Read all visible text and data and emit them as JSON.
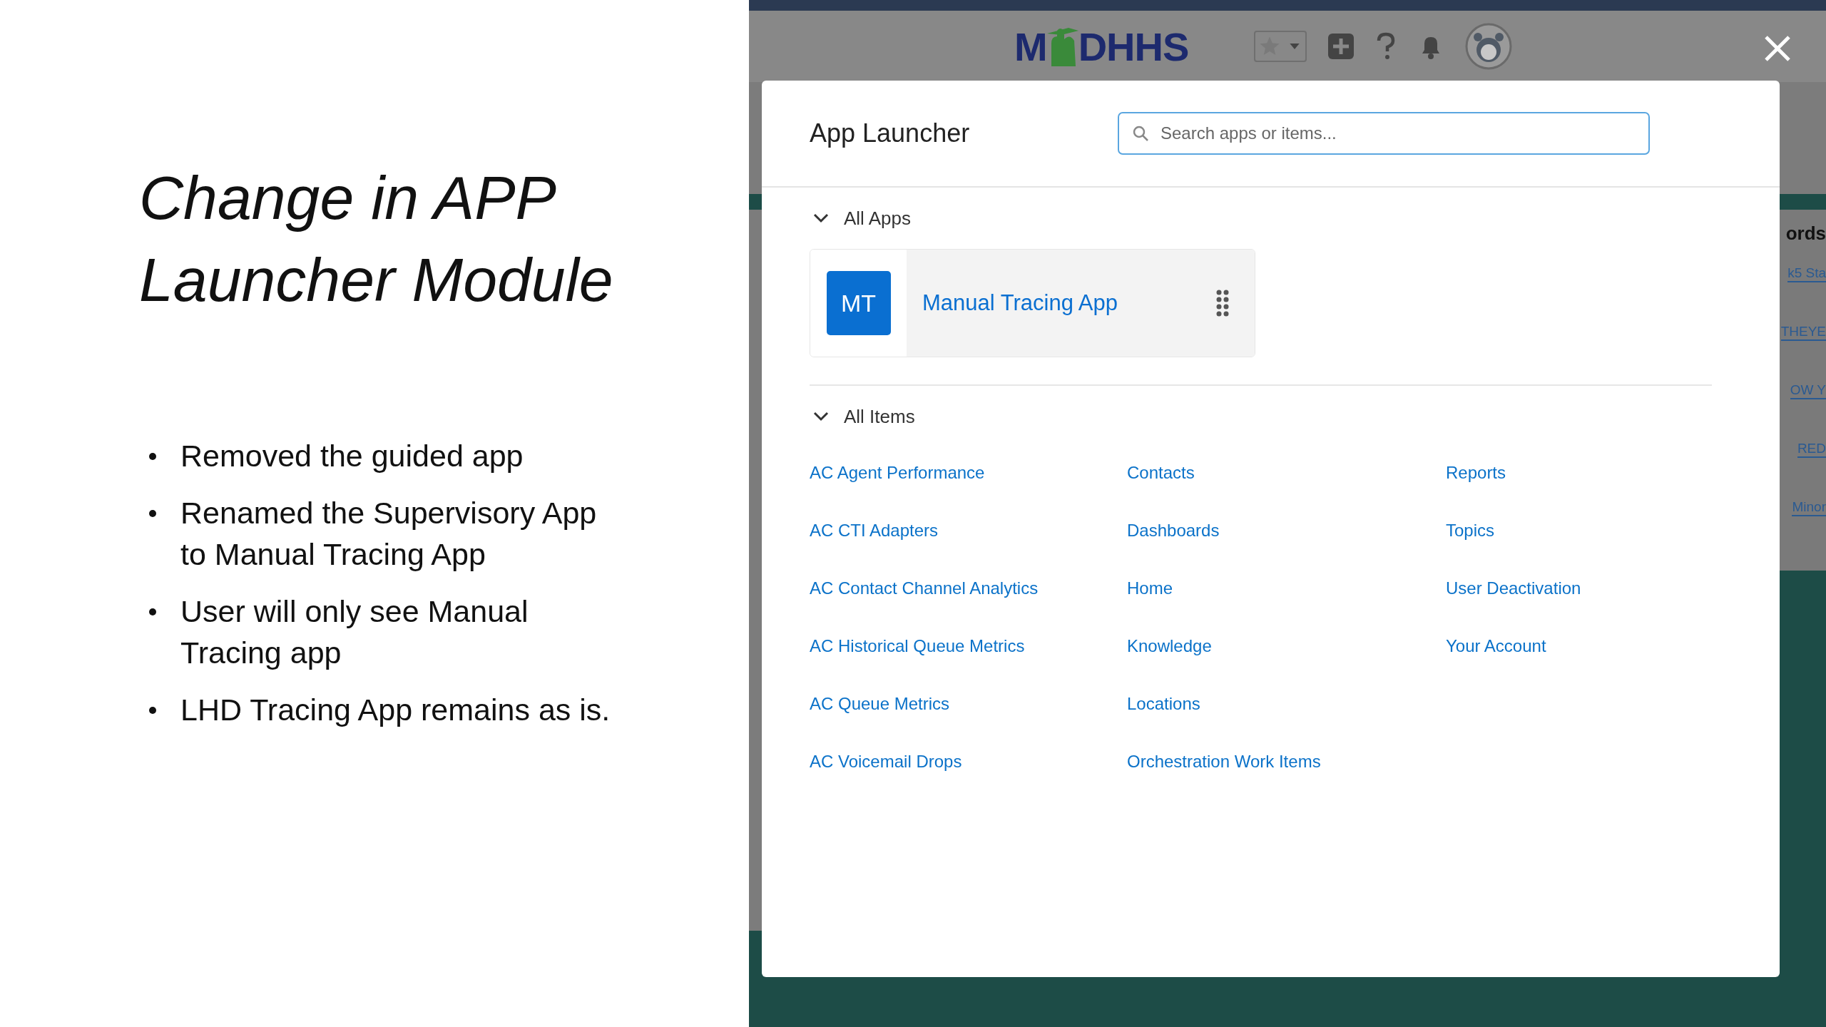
{
  "slide": {
    "title": "Change in APP Launcher Module",
    "bullets": [
      "Removed the guided app",
      "Renamed the Supervisory App to Manual Tracing App",
      "User will only see Manual Tracing app",
      "LHD Tracing App remains as is."
    ]
  },
  "app_header": {
    "logo": {
      "part_1": "M",
      "part_2": "DHHS"
    }
  },
  "background_records": {
    "heading": "ords",
    "links": [
      "k5 Sta",
      "THEYE",
      "OW Y",
      "RED",
      "Minor"
    ]
  },
  "app_launcher": {
    "title": "App Launcher",
    "search": {
      "placeholder": "Search apps or items..."
    },
    "sections": [
      {
        "kind": "apps",
        "label": "All Apps",
        "expanded": true,
        "apps": [
          {
            "initials": "MT",
            "name": "Manual Tracing App"
          }
        ]
      },
      {
        "kind": "items",
        "label": "All Items",
        "expanded": true,
        "items": [
          "AC Agent Performance",
          "AC CTI Adapters",
          "AC Contact Channel Analytics",
          "AC Historical Queue Metrics",
          "AC Queue Metrics",
          "AC Voicemail Drops",
          "Contacts",
          "Dashboards",
          "Home",
          "Knowledge",
          "Locations",
          "Orchestration Work Items",
          "Reports",
          "Topics",
          "User Deactivation",
          "Your Account"
        ]
      }
    ]
  }
}
